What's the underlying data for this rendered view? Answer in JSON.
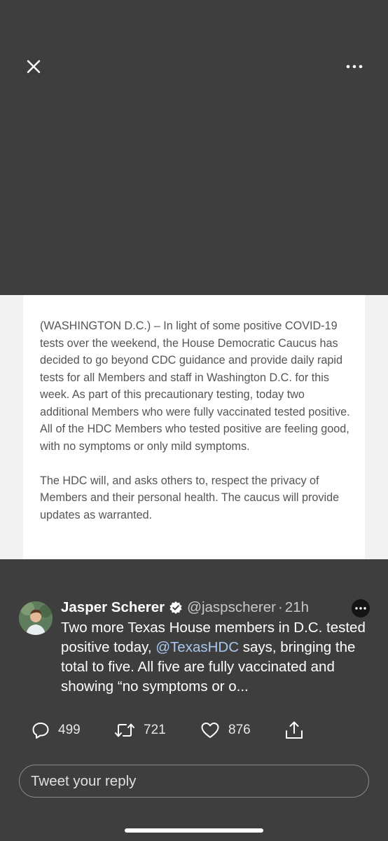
{
  "document": {
    "paragraphs": [
      "(WASHINGTON D.C.) – In light of some positive COVID-19 tests over the weekend, the House Democratic Caucus has decided to go beyond CDC guidance and provide daily rapid tests for all Members and staff in Washington D.C. for this week. As part of this precautionary testing, today two additional Members who were fully vaccinated tested positive. All of the HDC Members who tested positive are feeling good, with no symptoms or only mild symptoms.",
      "The HDC will, and asks others to, respect the privacy of Members and their personal health. The caucus will provide updates as warranted."
    ]
  },
  "tweet": {
    "author_name": "Jasper Scherer",
    "handle": "@jaspscherer",
    "separator": "·",
    "time": "21h",
    "text_before": "Two more Texas House members in D.C. tested positive today, ",
    "mention": "@TexasHDC",
    "text_after": " says, bringing the total to five. All five are fully vaccinated and showing “no symptoms or o..."
  },
  "actions": {
    "replies": "499",
    "retweets": "721",
    "likes": "876"
  },
  "reply_box": {
    "placeholder": "Tweet your reply"
  },
  "icons": {
    "close": "close-icon",
    "more": "more-horizontal-icon",
    "verified": "verified-badge-icon",
    "tweet_menu": "more-circle-icon",
    "reply": "reply-icon",
    "retweet": "retweet-icon",
    "like": "heart-icon",
    "share": "share-icon"
  },
  "colors": {
    "background": "#3e3e3e",
    "mention": "#a9c8ee",
    "document_text": "#555555"
  }
}
